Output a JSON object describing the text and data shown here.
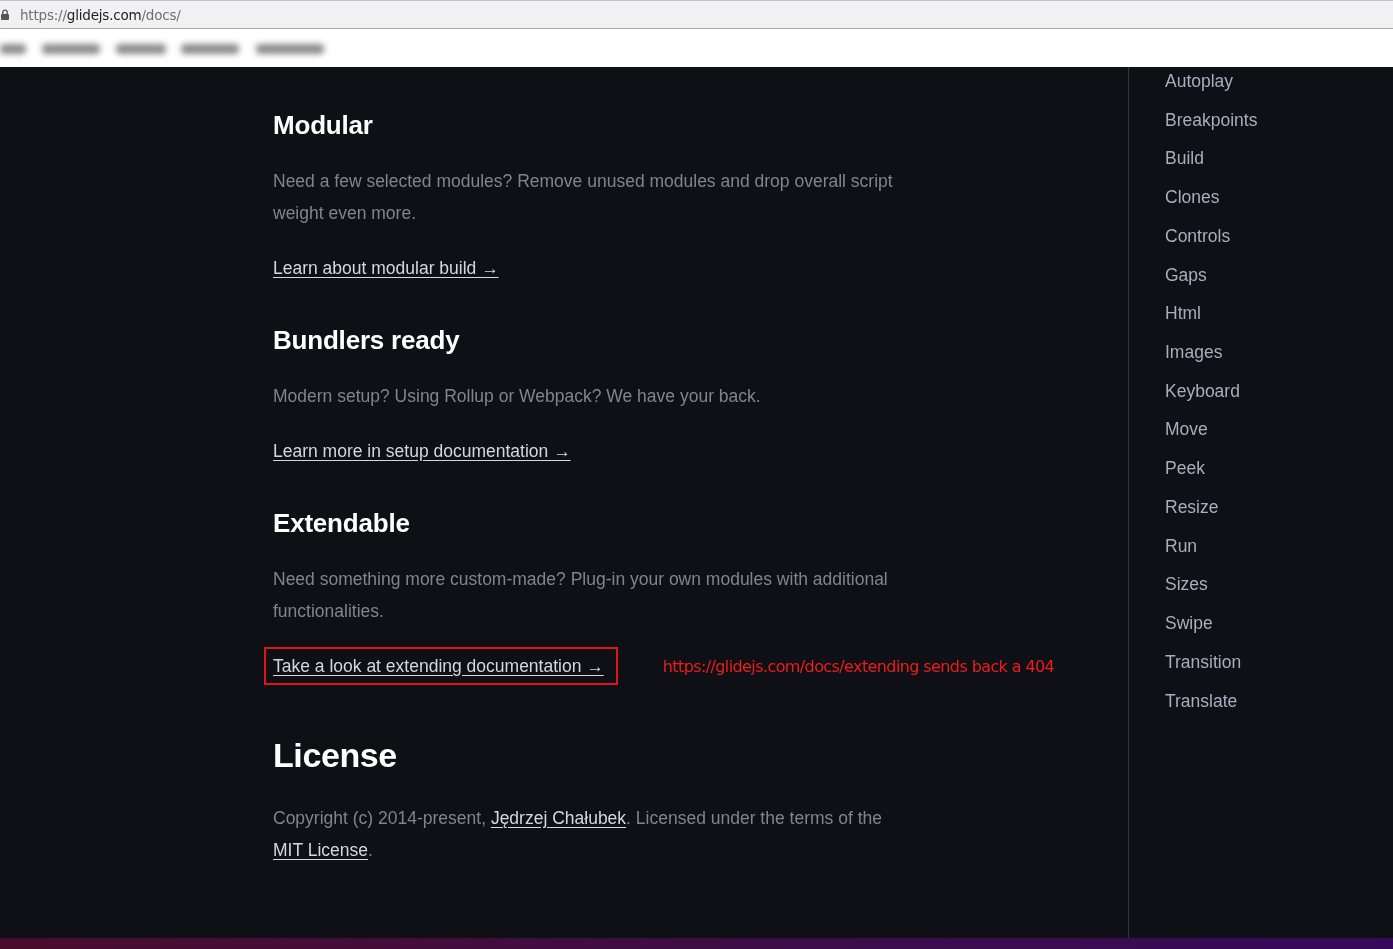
{
  "browser": {
    "address_bar": {
      "scheme": "https://",
      "host": "glidejs.com",
      "path": "/docs/"
    }
  },
  "sections": [
    {
      "heading": "Modular",
      "text": "Need a few selected modules? Remove unused modules and drop overall script weight even more.",
      "link": {
        "label": "Learn about modular build →",
        "highlighted": false
      }
    },
    {
      "heading": "Bundlers ready",
      "text": "Modern setup? Using Rollup or Webpack? We have your back.",
      "link": {
        "label": "Learn more in setup documentation →",
        "highlighted": false
      }
    },
    {
      "heading": "Extendable",
      "text": "Need something more custom-made? Plug-in your own modules with additional functionalities.",
      "link": {
        "label": "Take a look at extending documentation →",
        "highlighted": true
      },
      "annotation": "https://glidejs.com/docs/extending sends back a 404"
    }
  ],
  "license": {
    "heading": "License",
    "parts": [
      {
        "kind": "text",
        "text": "Copyright (c) 2014-present, "
      },
      {
        "kind": "link",
        "text": "Jędrzej Chałubek"
      },
      {
        "kind": "text",
        "text": ". Licensed under the terms of the "
      },
      {
        "kind": "link",
        "text": "MIT License"
      },
      {
        "kind": "text",
        "text": "."
      }
    ]
  },
  "sidebar": {
    "items": [
      "Autoplay",
      "Breakpoints",
      "Build",
      "Clones",
      "Controls",
      "Gaps",
      "Html",
      "Images",
      "Keyboard",
      "Move",
      "Peek",
      "Resize",
      "Run",
      "Sizes",
      "Swipe",
      "Transition",
      "Translate"
    ]
  }
}
